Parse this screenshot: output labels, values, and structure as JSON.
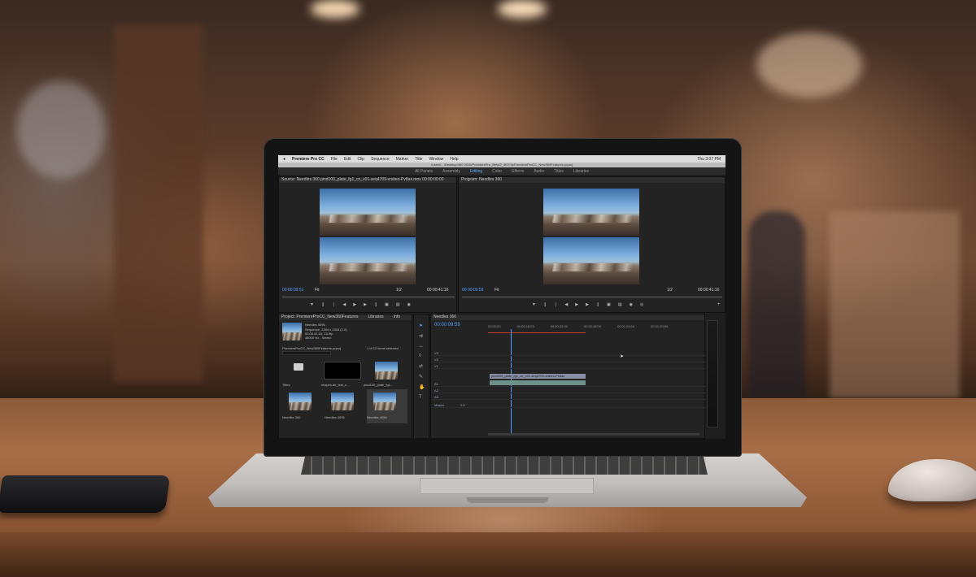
{
  "menubar": {
    "app_name": "Premiere Pro CC",
    "items": [
      "File",
      "Edit",
      "Clip",
      "Sequence",
      "Marker",
      "Title",
      "Window",
      "Help"
    ],
    "clock": "Thu 3:07 PM"
  },
  "pathbar": "/Users/.../Desktop/360 2016/PremierePro_Beta/2_4K/ClipPremiereProCC_New360Features.prproj",
  "workspaces": {
    "items": [
      "All Panels",
      "Assembly",
      "Editing",
      "Color",
      "Effects",
      "Audio",
      "Titles",
      "Libraries"
    ],
    "active": "Editing"
  },
  "source_monitor": {
    "tab": "Source: Needles 360  pind100_plate_fg1_cn_v01-seq4709-vrsiteo-Pv8ax.mov  00:00:00:00",
    "timecode_in": "00:00:08:51",
    "timecode_out": "00:00:41:16",
    "fit": "Fit",
    "ratio": "1/2"
  },
  "program_monitor": {
    "tab": "Program: Needles 360",
    "timecode_in": "00:00:09:59",
    "timecode_out": "00:00:41:16",
    "fit": "Fit",
    "ratio": "1/2"
  },
  "project_panel": {
    "tabs": [
      "Project: PremiereProCC_New360Features",
      "Libraries",
      "Info"
    ],
    "sequence_name": "Needles 4096",
    "sequence_meta": [
      "Sequence, 2304 x 2304 (1.0)",
      "00:00:41:16, 23.9fp",
      "48000 Hz - Stereo"
    ],
    "file_name": "PremiereProCC_New360Features.prproj",
    "selection_count": "1 of 12 items selected",
    "items": [
      "Titles",
      "shapes.dk_test_c...",
      "pind100_plate_fg1...",
      "Needles 360",
      "Needles 4096",
      "Needles 4096"
    ]
  },
  "timeline": {
    "tab": "Needles 360",
    "timecode": "00:00:09:59",
    "ruler": [
      "00:00:00",
      "00:00:16:00",
      "00:00:32:00",
      "00:00:48:00",
      "00:01:04:00",
      "00:01:20:00"
    ],
    "tracks": [
      "V3",
      "V2",
      "V1",
      "A1",
      "A2",
      "A3",
      "Master"
    ],
    "video_clip": "pind100_plate_fg1_cn_v01-seq4709-vrsiteo-Pv8ax",
    "master_value": "0.0"
  },
  "icons": {
    "transport": [
      "mark-in-icon",
      "mark-out-icon",
      "go-to-in-icon",
      "step-back-icon",
      "play-icon",
      "step-forward-icon",
      "go-to-out-icon",
      "insert-icon",
      "overwrite-icon",
      "export-frame-icon"
    ],
    "tools": [
      "selection-tool-icon",
      "track-select-icon",
      "ripple-edit-icon",
      "razor-tool-icon",
      "slip-tool-icon",
      "pen-tool-icon",
      "hand-tool-icon",
      "type-tool-icon"
    ]
  },
  "colors": {
    "accent_blue": "#4fa0ff",
    "app_bg": "#1e1e1e",
    "table_wood": "#a86e46"
  }
}
